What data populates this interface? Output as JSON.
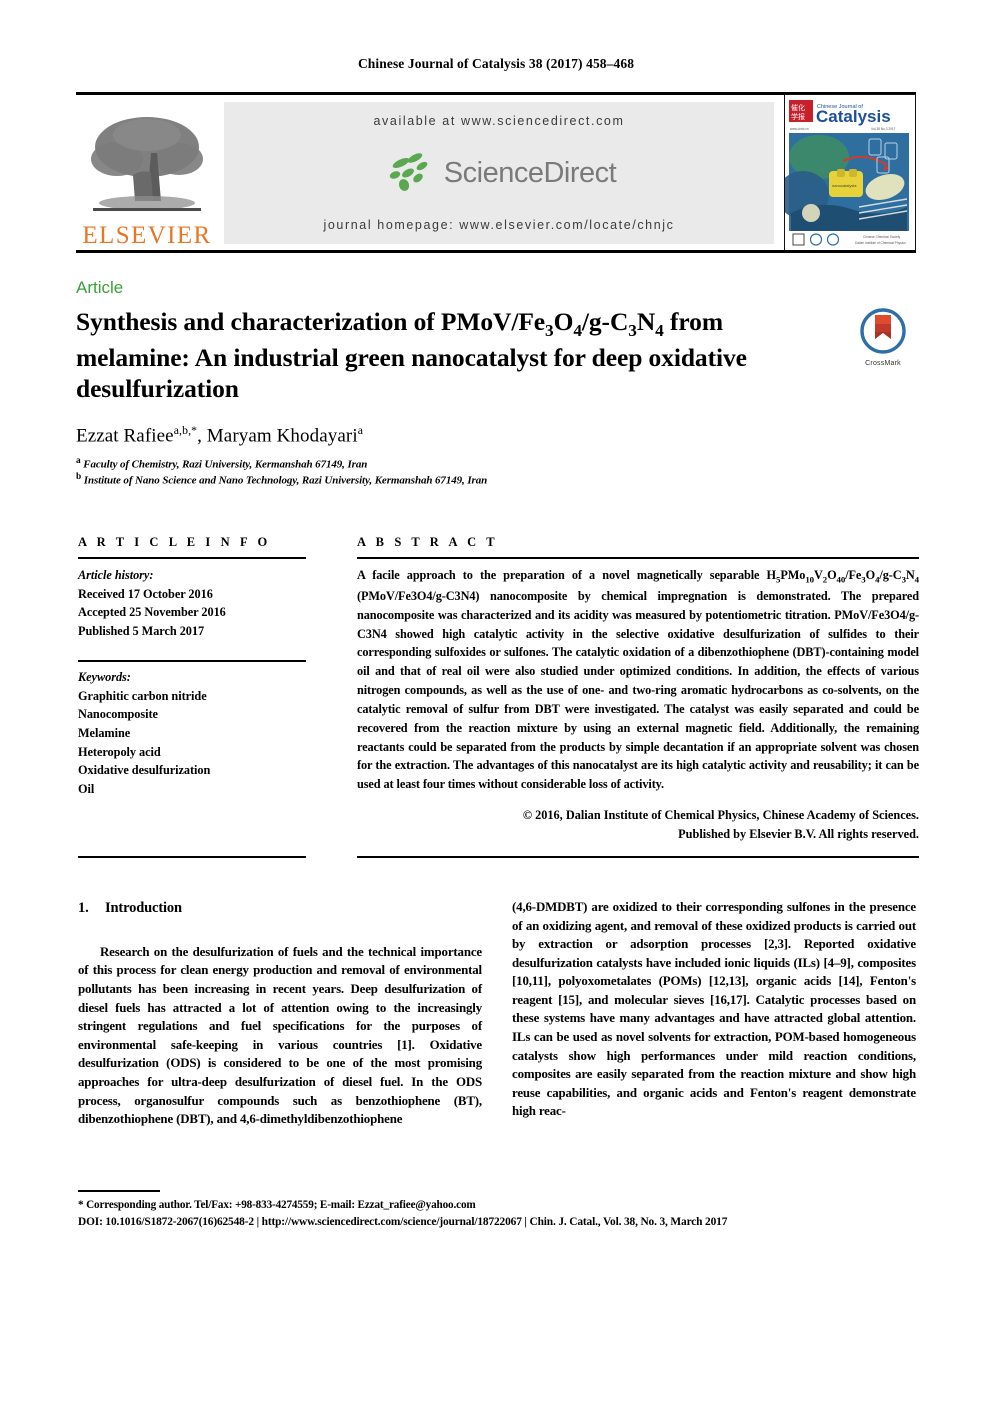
{
  "running_head": "Chinese Journal of Catalysis 38 (2017) 458–468",
  "masthead": {
    "publisher_name": "ELSEVIER",
    "available_at": "available at www.sciencedirect.com",
    "sciencedirect_wordmark": "ScienceDirect",
    "journal_homepage": "journal homepage: www.elsevier.com/locate/chnjc",
    "cover_journal_name_cn": "Catalysis",
    "cover_journal_kicker": "Chinese Journal of"
  },
  "article": {
    "kicker": "Article",
    "title_line1_pre": "Synthesis and characterization of PMoV/Fe",
    "title_sub1": "3",
    "title_mid1": "O",
    "title_sub2": "4",
    "title_mid2": "/g-C",
    "title_sub3": "3",
    "title_mid3": "N",
    "title_sub4": "4",
    "title_tail": " from melamine: An industrial green nanocatalyst for deep oxidative desulfurization",
    "title_plain": "Synthesis and characterization of PMoV/Fe3O4/g-C3N4 from melamine: An industrial green nanocatalyst for deep oxidative desulfurization",
    "crossmark_label": "CrossMark"
  },
  "authors": {
    "line": "Ezzat Rafiee a,b,*, Maryam Khodayari a",
    "name1": "Ezzat Rafiee",
    "name1_sup": "a,b,*",
    "name2": "Maryam Khodayari",
    "name2_sup": "a",
    "affiliations": [
      {
        "marker": "a",
        "text": "Faculty of Chemistry, Razi University, Kermanshah 67149, Iran"
      },
      {
        "marker": "b",
        "text": "Institute of Nano Science and Nano Technology, Razi University, Kermanshah 67149, Iran"
      }
    ]
  },
  "article_info": {
    "heading": "A R T I C L E    I N F O",
    "history_label": "Article history:",
    "history": [
      "Received 17 October 2016",
      "Accepted 25 November 2016",
      "Published 5 March 2017"
    ],
    "keywords_label": "Keywords:",
    "keywords": [
      "Graphitic carbon nitride",
      "Nanocomposite",
      "Melamine",
      "Heteropoly acid",
      "Oxidative desulfurization",
      "Oil"
    ]
  },
  "abstract": {
    "heading": "A B S T R A C T",
    "text_part1": "A facile approach to the preparation of a novel magnetically separable H",
    "formula_h_sub": "5",
    "text_part2": "PMo",
    "formula_mo_sub": "10",
    "text_part3": "V",
    "formula_v_sub": "2",
    "text_part4": "O",
    "formula_o_sub": "40",
    "text_part5": "/Fe",
    "formula_fe_sub": "3",
    "text_part6": "O",
    "formula_o2_sub": "4",
    "text_part7": "/g-C",
    "formula_c_sub": "3",
    "text_part8": "N",
    "formula_n_sub": "4",
    "text_rest": " (PMoV/Fe3O4/g-C3N4) nanocomposite by chemical impregnation is demonstrated. The prepared nanocomposite was characterized and its acidity was measured by potentiometric titration. PMoV/Fe3O4/g-C3N4 showed high catalytic activity in the selective oxidative desulfurization of sulfides to their corresponding sulfoxides or sulfones. The catalytic oxidation of a dibenzothiophene (DBT)-containing model oil and that of real oil were also studied under optimized conditions. In addition, the effects of various nitrogen compounds, as well as the use of one- and two-ring aromatic hydrocarbons as co-solvents, on the catalytic removal of sulfur from DBT were investigated. The catalyst was easily separated and could be recovered from the reaction mixture by using an external magnetic field. Additionally, the remaining reactants could be separated from the products by simple decantation if an appropriate solvent was chosen for the extraction. The advantages of this nanocatalyst are its high catalytic activity and reusability; it can be used at least four times without considerable loss of activity.",
    "copyright_line1": "© 2016, Dalian Institute of Chemical Physics, Chinese Academy of Sciences.",
    "copyright_line2": "Published by Elsevier B.V. All rights reserved."
  },
  "introduction": {
    "number": "1.",
    "title": "Introduction",
    "left_text": "Research on the desulfurization of fuels and the technical importance of this process for clean energy production and removal of environmental pollutants has been increasing in recent years. Deep desulfurization of diesel fuels has attracted a lot of attention owing to the increasingly stringent regulations and fuel specifications for the purposes of environmental safe-keeping in various countries [1]. Oxidative desulfurization (ODS) is considered to be one of the most promising approaches for ultra-deep desulfurization of diesel fuel. In the ODS process, organosulfur compounds such as benzothiophene (BT), dibenzothiophene (DBT), and 4,6-dimethyldibenzothiophene",
    "right_text": "(4,6-DMDBT) are oxidized to their corresponding sulfones in the presence of an oxidizing agent, and removal of these oxidized products is carried out by extraction or adsorption processes [2,3]. Reported oxidative desulfurization catalysts have included ionic liquids (ILs) [4–9], composites [10,11], polyoxometalates (POMs) [12,13], organic acids [14], Fenton's reagent [15], and molecular sieves [16,17]. Catalytic processes based on these systems have many advantages and have attracted global attention. ILs can be used as novel solvents for extraction, POM-based homogeneous catalysts show high performances under mild reaction conditions, composites are easily separated from the reaction mixture and show high reuse capabilities, and organic acids and Fenton's reagent demonstrate high reac-"
  },
  "footer": {
    "corresponding": "* Corresponding author. Tel/Fax: +98-833-4274559; E-mail: Ezzat_rafiee@yahoo.com",
    "doi_line": "DOI: 10.1016/S1872-2067(16)62548-2 | http://www.sciencedirect.com/science/journal/18722067 | Chin. J. Catal., Vol. 38, No. 3, March 2017"
  },
  "colors": {
    "elsevier_orange": "#E87722",
    "article_green": "#3aa038",
    "sciencedirect_green": "#5aa84f",
    "sciencedirect_gray": "#7a7a7a",
    "band_background": "#eaeaea"
  }
}
